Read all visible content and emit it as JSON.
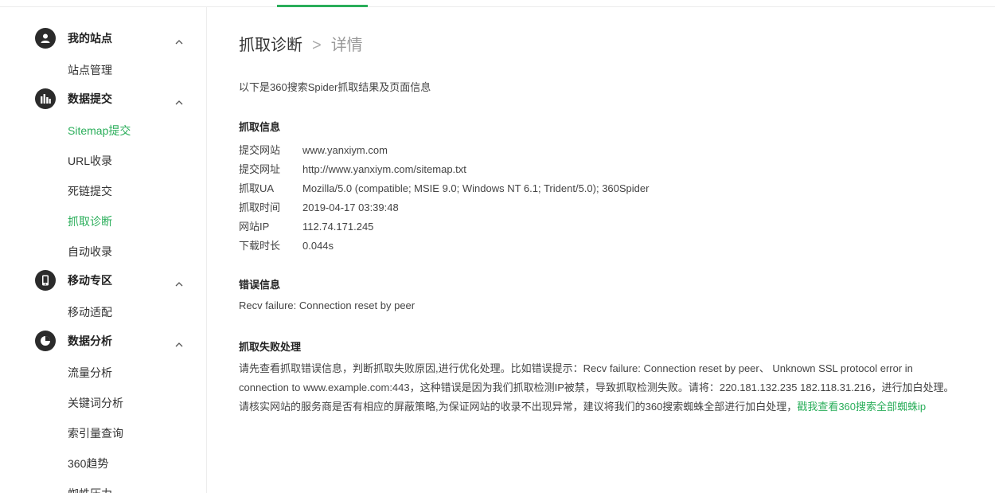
{
  "sidebar": {
    "groups": [
      {
        "title": "我的站点",
        "icon": "user-icon",
        "items": [
          {
            "label": "站点管理",
            "active": false
          }
        ]
      },
      {
        "title": "数据提交",
        "icon": "bar-chart-icon",
        "items": [
          {
            "label": "Sitemap提交",
            "active": true
          },
          {
            "label": "URL收录",
            "active": false
          },
          {
            "label": "死链提交",
            "active": false
          },
          {
            "label": "抓取诊断",
            "active": true
          },
          {
            "label": "自动收录",
            "active": false
          }
        ]
      },
      {
        "title": "移动专区",
        "icon": "mobile-icon",
        "items": [
          {
            "label": "移动适配",
            "active": false
          }
        ]
      },
      {
        "title": "数据分析",
        "icon": "pie-chart-icon",
        "items": [
          {
            "label": "流量分析",
            "active": false
          },
          {
            "label": "关键词分析",
            "active": false
          },
          {
            "label": "索引量查询",
            "active": false
          },
          {
            "label": "360趋势",
            "active": false
          },
          {
            "label": "蜘蛛压力",
            "active": false
          }
        ]
      }
    ]
  },
  "breadcrumb": {
    "parent": "抓取诊断",
    "separator": ">",
    "current": "详情"
  },
  "intro": "以下是360搜索Spider抓取结果及页面信息",
  "fetch_info": {
    "title": "抓取信息",
    "rows": [
      {
        "key": "提交网站",
        "value": "www.yanxiym.com"
      },
      {
        "key": "提交网址",
        "value": "http://www.yanxiym.com/sitemap.txt"
      },
      {
        "key": "抓取UA",
        "value": "Mozilla/5.0 (compatible; MSIE 9.0; Windows NT 6.1; Trident/5.0); 360Spider"
      },
      {
        "key": "抓取时间",
        "value": "2019-04-17 03:39:48"
      },
      {
        "key": "网站IP",
        "value": "112.74.171.245"
      },
      {
        "key": "下载时长",
        "value": "0.044s"
      }
    ]
  },
  "error_info": {
    "title": "错误信息",
    "text": "Recv failure: Connection reset by peer"
  },
  "failure": {
    "title": "抓取失败处理",
    "para1": "请先查看抓取错误信息，判断抓取失败原因,进行优化处理。比如错误提示：Recv failure: Connection reset by peer、 Unknown SSL protocol error in connection to www.example.com:443，这种错误是因为我们抓取检测IP被禁，导致抓取检测失败。请将：220.181.132.235 182.118.31.216，进行加白处理。",
    "para2": "请核实网站的服务商是否有相应的屏蔽策略,为保证网站的收录不出现异常，建议将我们的360搜索蜘蛛全部进行加白处理，",
    "link": "戳我查看360搜索全部蜘蛛ip"
  },
  "colors": {
    "accent": "#2aae5a",
    "text": "#333333",
    "icon_bg": "#2b2b2b"
  }
}
